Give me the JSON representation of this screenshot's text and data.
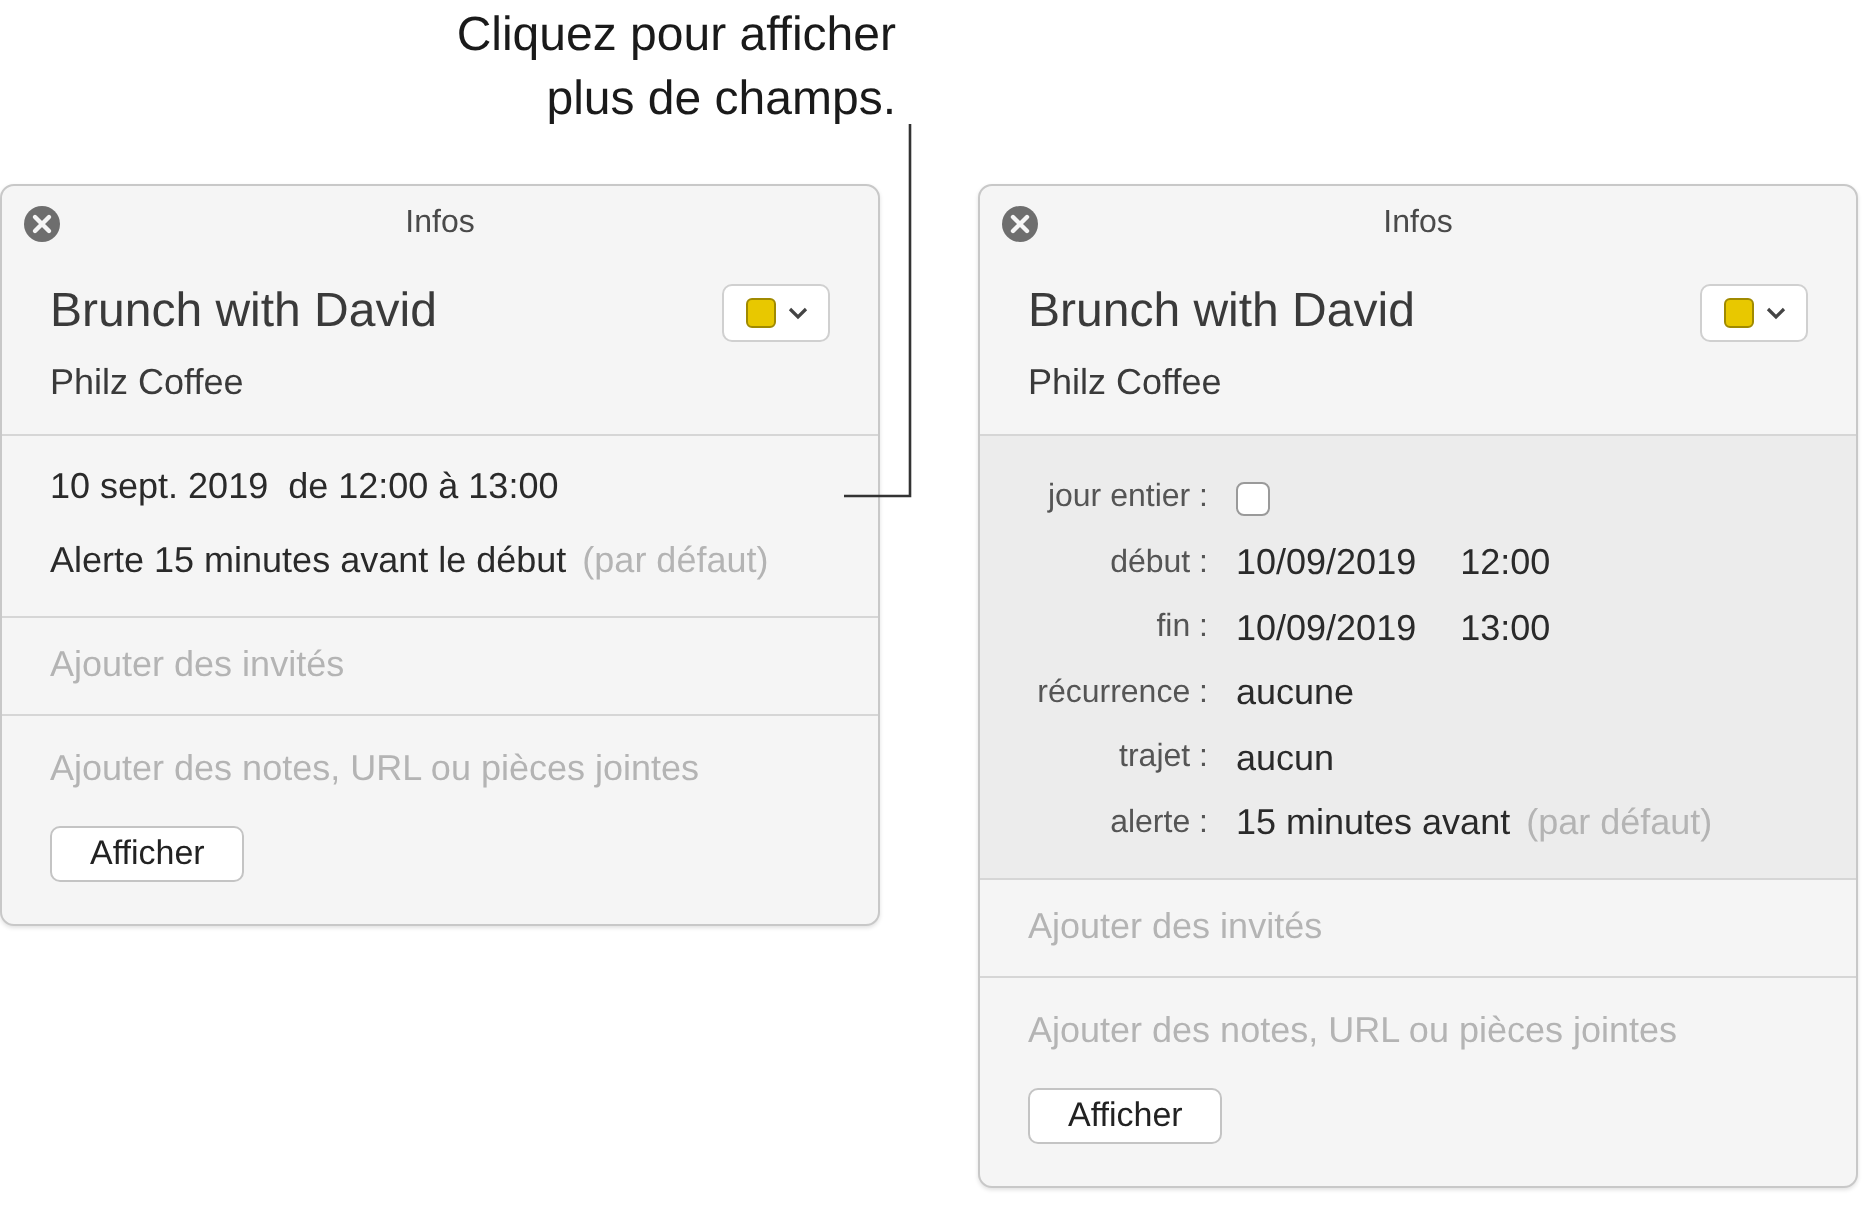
{
  "callout": {
    "lines": [
      "Cliquez pour afficher",
      "plus de champs."
    ]
  },
  "panels": [
    {
      "kind": "summary",
      "window_title": "Infos",
      "event_title": "Brunch with David",
      "location": "Philz Coffee",
      "color": "#e8c800",
      "date": "10 sept. 2019",
      "time_range": "de 12:00 à 13:00",
      "alert": "Alerte 15 minutes avant le début",
      "alert_note": "(par défaut)",
      "invitees_placeholder": "Ajouter des invités",
      "notes_placeholder": "Ajouter des notes, URL ou pièces jointes",
      "button": "Afficher"
    },
    {
      "kind": "expanded",
      "window_title": "Infos",
      "event_title": "Brunch with David",
      "location": "Philz Coffee",
      "color": "#e8c800",
      "fields": [
        {
          "kind": "checkbox",
          "label": "jour entier :",
          "checked": false
        },
        {
          "kind": "datetime",
          "label": "début :",
          "date": "10/09/2019",
          "time": "12:00"
        },
        {
          "kind": "datetime",
          "label": "fin :",
          "date": "10/09/2019",
          "time": "13:00"
        },
        {
          "kind": "value",
          "label": "récurrence :",
          "value": "aucune"
        },
        {
          "kind": "value",
          "label": "trajet :",
          "value": "aucun"
        },
        {
          "kind": "value",
          "label": "alerte :",
          "value": "15 minutes avant",
          "note": "(par défaut)"
        }
      ],
      "invitees_placeholder": "Ajouter des invités",
      "notes_placeholder": "Ajouter des notes, URL ou pièces jointes",
      "button": "Afficher"
    }
  ]
}
